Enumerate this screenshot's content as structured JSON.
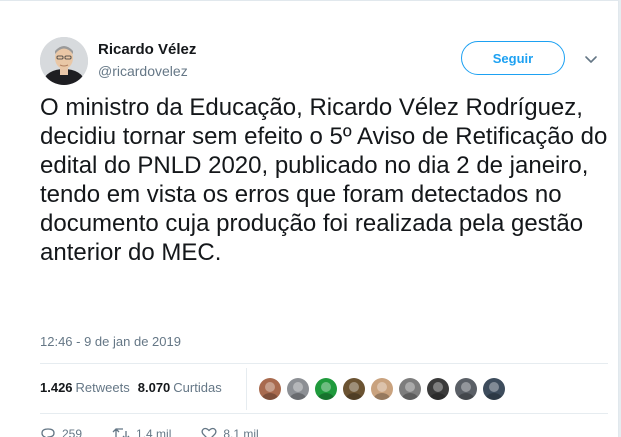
{
  "author": {
    "name": "Ricardo Vélez",
    "handle": "@ricardovelez"
  },
  "follow_label": "Seguir",
  "tweet_text": "O ministro da Educação, Ricardo Vélez Rodríguez, decidiu tornar sem efeito o 5º Aviso de Retificação do edital do PNLD 2020, publicado no dia 2 de janeiro, tendo em vista os erros que foram detectados no documento cuja produção foi realizada pela gestão anterior do MEC.",
  "timestamp": "12:46 - 9 de jan de 2019",
  "stats": {
    "retweets_count": "1.426",
    "retweets_label": "Retweets",
    "likes_count": "8.070",
    "likes_label": "Curtidas"
  },
  "actions": {
    "replies": "259",
    "retweets": "1,4 mil",
    "likes": "8,1 mil"
  },
  "liker_avatars": [
    "#a86a4e",
    "#8c8f94",
    "#1f9a3c",
    "#6b5332",
    "#c9a27e",
    "#7d7d7d",
    "#3a3a3a",
    "#5a5f66",
    "#3d4c5c"
  ],
  "colors": {
    "accent": "#1da1f2",
    "text": "#14171a",
    "muted": "#657786"
  }
}
